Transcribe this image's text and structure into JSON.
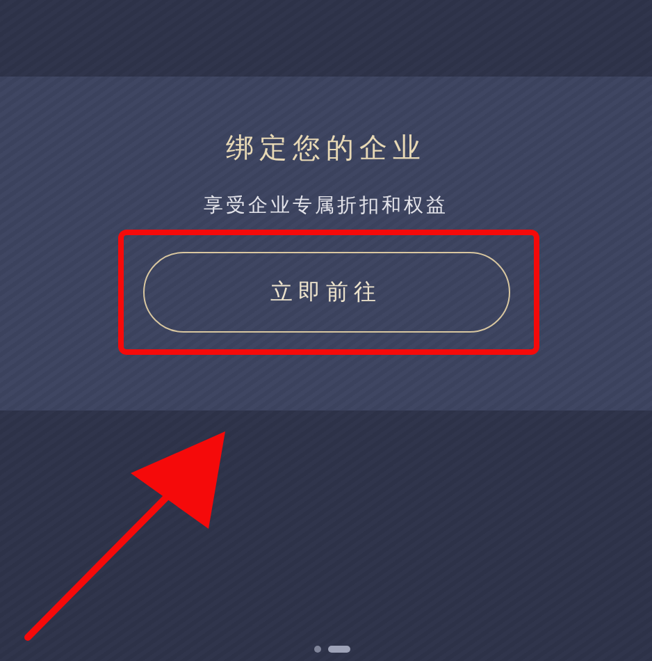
{
  "card": {
    "title": "绑定您的企业",
    "subtitle": "享受企业专属折扣和权益",
    "button": "立即前往"
  },
  "page_dots": [
    {
      "selected": false
    },
    {
      "selected": true
    }
  ]
}
